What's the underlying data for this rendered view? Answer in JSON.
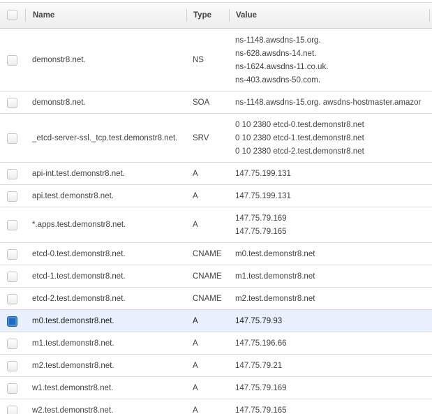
{
  "columns": {
    "name": "Name",
    "type": "Type",
    "value": "Value"
  },
  "records": [
    {
      "name": "demonstr8.net.",
      "type": "NS",
      "values": [
        "ns-1148.awsdns-15.org.",
        "ns-628.awsdns-14.net.",
        "ns-1624.awsdns-11.co.uk.",
        "ns-403.awsdns-50.com."
      ],
      "selected": false
    },
    {
      "name": "demonstr8.net.",
      "type": "SOA",
      "values": [
        "ns-1148.awsdns-15.org. awsdns-hostmaster.amazor"
      ],
      "selected": false
    },
    {
      "name": "_etcd-server-ssl._tcp.test.demonstr8.net.",
      "type": "SRV",
      "values": [
        "0 10 2380 etcd-0.test.demonstr8.net",
        "0 10 2380 etcd-1.test.demonstr8.net",
        "0 10 2380 etcd-2.test.demonstr8.net"
      ],
      "selected": false
    },
    {
      "name": "api-int.test.demonstr8.net.",
      "type": "A",
      "values": [
        "147.75.199.131"
      ],
      "selected": false
    },
    {
      "name": "api.test.demonstr8.net.",
      "type": "A",
      "values": [
        "147.75.199.131"
      ],
      "selected": false
    },
    {
      "name": "*.apps.test.demonstr8.net.",
      "type": "A",
      "values": [
        "147.75.79.169",
        "147.75.79.165"
      ],
      "selected": false
    },
    {
      "name": "etcd-0.test.demonstr8.net.",
      "type": "CNAME",
      "values": [
        "m0.test.demonstr8.net"
      ],
      "selected": false
    },
    {
      "name": "etcd-1.test.demonstr8.net.",
      "type": "CNAME",
      "values": [
        "m1.test.demonstr8.net"
      ],
      "selected": false
    },
    {
      "name": "etcd-2.test.demonstr8.net.",
      "type": "CNAME",
      "values": [
        "m2.test.demonstr8.net"
      ],
      "selected": false
    },
    {
      "name": "m0.test.demonstr8.net.",
      "type": "A",
      "values": [
        "147.75.79.93"
      ],
      "selected": true
    },
    {
      "name": "m1.test.demonstr8.net.",
      "type": "A",
      "values": [
        "147.75.196.66"
      ],
      "selected": false
    },
    {
      "name": "m2.test.demonstr8.net.",
      "type": "A",
      "values": [
        "147.75.79.21"
      ],
      "selected": false
    },
    {
      "name": "w1.test.demonstr8.net.",
      "type": "A",
      "values": [
        "147.75.79.169"
      ],
      "selected": false
    },
    {
      "name": "w2.test.demonstr8.net.",
      "type": "A",
      "values": [
        "147.75.79.165"
      ],
      "selected": false
    }
  ]
}
